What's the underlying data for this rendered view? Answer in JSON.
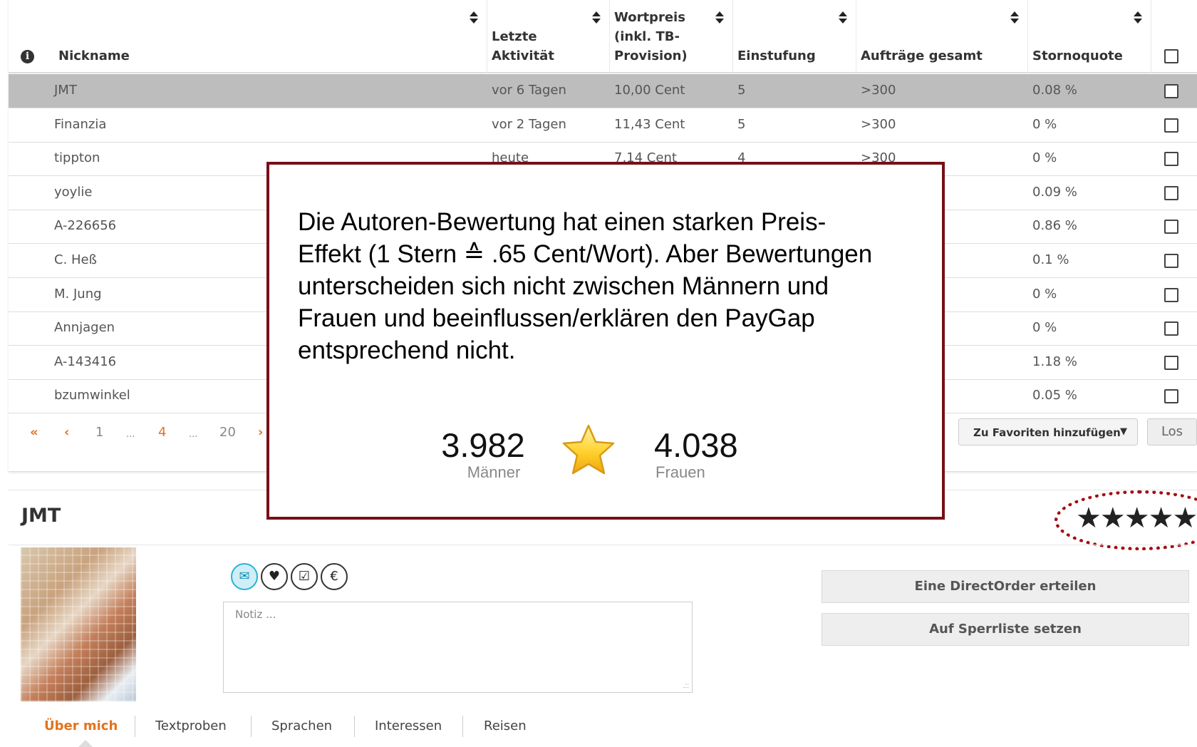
{
  "table": {
    "columns": [
      {
        "label": "Nickname",
        "sortable": true
      },
      {
        "label": "Letzte\nAktivität",
        "sortable": true
      },
      {
        "label": "Wortpreis\n(inkl. TB-\nProvision)",
        "sortable": true
      },
      {
        "label": "Einstufung",
        "sortable": true
      },
      {
        "label": "Aufträge gesamt",
        "sortable": true
      },
      {
        "label": "Stornoquote",
        "sortable": true
      }
    ],
    "rows": [
      {
        "nickname": "JMT",
        "activity": "vor 6 Tagen",
        "price": "10,00 Cent",
        "rating": "5",
        "orders": ">300",
        "cancel": "0.08 %",
        "selected": true
      },
      {
        "nickname": "Finanzia",
        "activity": "vor 2 Tagen",
        "price": "11,43 Cent",
        "rating": "5",
        "orders": ">300",
        "cancel": "0 %"
      },
      {
        "nickname": "tippton",
        "activity": "heute",
        "price": "7,14 Cent",
        "rating": "4",
        "orders": ">300",
        "cancel": "0 %"
      },
      {
        "nickname": "yoylie",
        "activity": "",
        "price": "",
        "rating": "",
        "orders": "",
        "cancel": "0.09 %"
      },
      {
        "nickname": "A-226656",
        "activity": "",
        "price": "",
        "rating": "",
        "orders": "",
        "cancel": "0.86 %"
      },
      {
        "nickname": "C. Heß",
        "activity": "",
        "price": "",
        "rating": "",
        "orders": "",
        "cancel": "0.1 %"
      },
      {
        "nickname": "M. Jung",
        "activity": "",
        "price": "",
        "rating": "",
        "orders": "",
        "cancel": "0 %"
      },
      {
        "nickname": "Annjagen",
        "activity": "",
        "price": "",
        "rating": "",
        "orders": "",
        "cancel": "0 %"
      },
      {
        "nickname": "A-143416",
        "activity": "",
        "price": "",
        "rating": "",
        "orders": "",
        "cancel": "1.18 %"
      },
      {
        "nickname": "bzumwinkel",
        "activity": "",
        "price": "",
        "rating": "",
        "orders": "",
        "cancel": "0.05 %"
      }
    ]
  },
  "pagination": {
    "first": "«",
    "prev": "‹",
    "pages": [
      "1",
      "...",
      "4",
      "...",
      "20"
    ],
    "current": "4",
    "next": "›"
  },
  "bulk": {
    "select_value": "Zu Favoriten hinzufügen",
    "go_label": "Los"
  },
  "profile": {
    "name": "JMT",
    "stars": "★★★★★",
    "rating": 5,
    "note_placeholder": "Notiz ...",
    "icons": [
      "envelope-icon",
      "heart-icon",
      "checkbox-icon",
      "euro-icon"
    ],
    "direct_order_label": "Eine DirectOrder erteilen",
    "block_label": "Auf Sperrliste setzen",
    "tabs": [
      "Über mich",
      "Textproben",
      "Sprachen",
      "Interessen",
      "Reisen"
    ],
    "active_tab": "Über mich"
  },
  "callout": {
    "lines": [
      "Die Autoren-Bewertung  hat einen starken Preis-",
      "Effekt (1 Stern ≙ .65 Cent/Wort). Aber Bewertungen",
      "unterscheiden sich nicht zwischen Männern und",
      "Frauen und beeinflussen/erklären den PayGap",
      "entsprechend nicht."
    ],
    "men_value": "3.982",
    "men_label": "Männer",
    "women_value": "4.038",
    "women_label": "Frauen"
  },
  "colors": {
    "accent": "#e3721c",
    "callout_border": "#761016",
    "highlight_ring": "#a40d12",
    "selected_row": "#bdbdbd"
  }
}
